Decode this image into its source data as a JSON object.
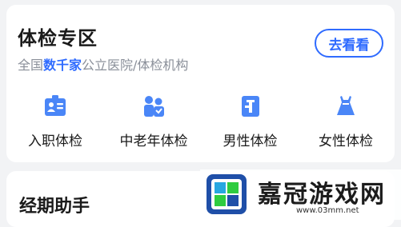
{
  "checkup": {
    "title": "体检专区",
    "subtitle_prefix": "全国",
    "subtitle_highlight": "数千家",
    "subtitle_suffix": "公立医院/体检机构",
    "view_button": "去看看",
    "categories": [
      {
        "label": "入职体检",
        "icon": "id-card-icon"
      },
      {
        "label": "中老年体检",
        "icon": "elderly-icon"
      },
      {
        "label": "男性体检",
        "icon": "male-icon"
      },
      {
        "label": "女性体检",
        "icon": "dress-icon"
      }
    ]
  },
  "period": {
    "title": "经期助手"
  },
  "watermark": {
    "brand": "嘉冠游戏网",
    "url": "www.03mm.net"
  },
  "colors": {
    "accent": "#2f6bff",
    "icon": "#4a86f7"
  }
}
